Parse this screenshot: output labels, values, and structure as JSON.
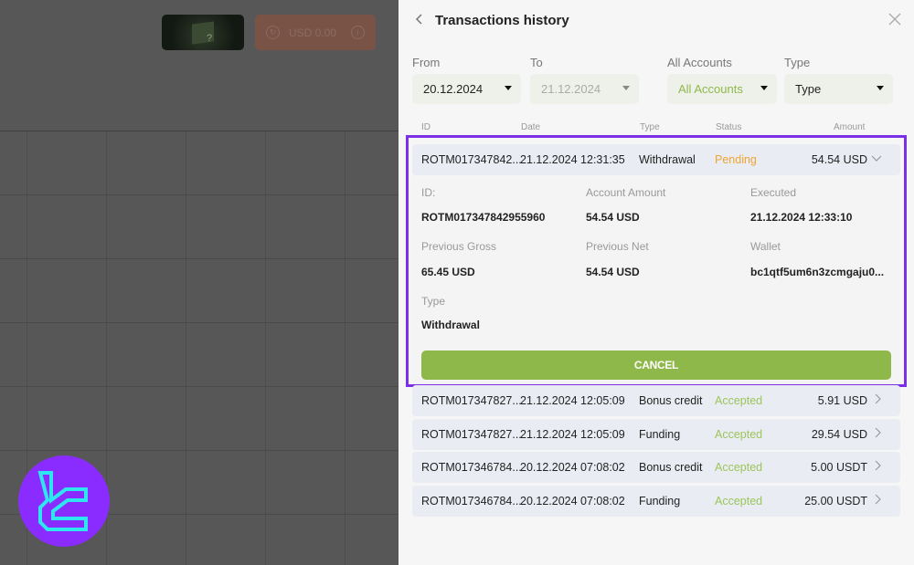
{
  "background": {
    "mystery_box_glyph": "?",
    "balance_label": "USD 0.00",
    "balance_icon_left": "refresh-icon",
    "balance_icon_right": "info-icon"
  },
  "panel": {
    "title": "Transactions history",
    "back_icon": "chevron-left-icon",
    "close_icon": "close-icon"
  },
  "filters": {
    "from": {
      "label": "From",
      "value": "20.12.2024"
    },
    "to": {
      "label": "To",
      "value": "21.12.2024"
    },
    "accounts": {
      "label": "All Accounts",
      "value": "All Accounts"
    },
    "type": {
      "label": "Type",
      "value": "Type"
    }
  },
  "table": {
    "columns": [
      "ID",
      "Date",
      "Type",
      "Status",
      "Amount"
    ],
    "rows": [
      {
        "id": "ROTM017347842...",
        "date": "21.12.2024 12:31:35",
        "type": "Withdrawal",
        "status": "Pending",
        "amount": "54.54 USD",
        "expanded": true
      },
      {
        "id": "ROTM017347827...",
        "date": "21.12.2024 12:05:09",
        "type": "Bonus credit",
        "status": "Accepted",
        "amount": "5.91 USD",
        "expanded": false
      },
      {
        "id": "ROTM017347827...",
        "date": "21.12.2024 12:05:09",
        "type": "Funding",
        "status": "Accepted",
        "amount": "29.54 USD",
        "expanded": false
      },
      {
        "id": "ROTM017346784...",
        "date": "20.12.2024 07:08:02",
        "type": "Bonus credit",
        "status": "Accepted",
        "amount": "5.00 USDT",
        "expanded": false
      },
      {
        "id": "ROTM017346784...",
        "date": "20.12.2024 07:08:02",
        "type": "Funding",
        "status": "Accepted",
        "amount": "25.00 USDT",
        "expanded": false
      }
    ]
  },
  "details": {
    "id": {
      "label": "ID:",
      "value": "ROTM017347842955960"
    },
    "account_amount": {
      "label": "Account Amount",
      "value": "54.54 USD"
    },
    "executed": {
      "label": "Executed",
      "value": "21.12.2024 12:33:10"
    },
    "previous_gross": {
      "label": "Previous Gross",
      "value": "65.45 USD"
    },
    "previous_net": {
      "label": "Previous Net",
      "value": "54.54 USD"
    },
    "wallet": {
      "label": "Wallet",
      "value": "bc1qtf5um6n3zcmgaju0..."
    },
    "type": {
      "label": "Type",
      "value": "Withdrawal"
    },
    "cancel_label": "CANCEL"
  },
  "colors": {
    "accent_green": "#8fb84a",
    "pending": "#f0a430",
    "accepted": "#9cc45a",
    "highlight": "#7b2fe6",
    "logo_bg": "#8a2cff",
    "logo_fg": "#2ee6f0"
  }
}
